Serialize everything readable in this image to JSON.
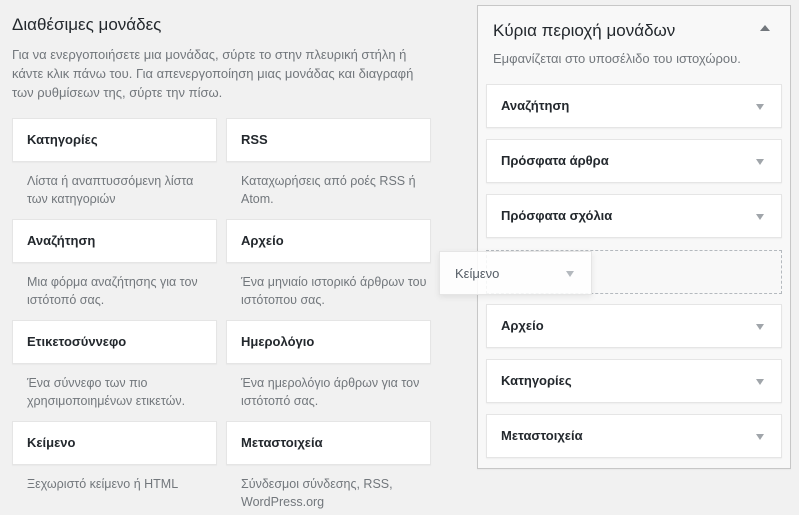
{
  "available": {
    "title": "Διαθέσιμες μονάδες",
    "description": "Για να ενεργοποιήσετε μια μονάδας, σύρτε το στην πλευρική στήλη ή κάντε κλικ πάνω του. Για απενεργοποίηση μιας μονάδας και διαγραφή των ρυθμίσεων της, σύρτε την πίσω.",
    "widgets": [
      {
        "title": "Κατηγορίες",
        "desc": "Λίστα ή αναπτυσσόμενη λίστα των κατηγοριών"
      },
      {
        "title": "RSS",
        "desc": "Καταχωρήσεις από ροές RSS ή Atom."
      },
      {
        "title": "Αναζήτηση",
        "desc": "Μια φόρμα αναζήτησης για τον ιστότοπό σας."
      },
      {
        "title": "Αρχείο",
        "desc": "Ένα μηνιαίο ιστορικό άρθρων του ιστότοπου σας."
      },
      {
        "title": "Ετικετοσύννεφο",
        "desc": "Ένα σύννεφο των πιο χρησιμοποιημένων ετικετών."
      },
      {
        "title": "Ημερολόγιο",
        "desc": "Ένα ημερολόγιο άρθρων για τον ιστότοπό σας."
      },
      {
        "title": "Κείμενο",
        "desc": "Ξεχωριστό κείμενο ή HTML"
      },
      {
        "title": "Μεταστοιχεία",
        "desc": "Σύνδεσμοι σύνδεσης, RSS, WordPress.org"
      }
    ]
  },
  "sidebar": {
    "title": "Κύρια περιοχή μονάδων",
    "description": "Εμφανίζεται στο υποσέλιδο του ιστοχώρου.",
    "widgets": [
      {
        "title": "Αναζήτηση"
      },
      {
        "title": "Πρόσφατα άρθρα"
      },
      {
        "title": "Πρόσφατα σχόλια"
      },
      {
        "title": "Αρχείο"
      },
      {
        "title": "Κατηγορίες"
      },
      {
        "title": "Μεταστοιχεία"
      }
    ]
  },
  "dragging": {
    "title": "Κείμενο"
  }
}
